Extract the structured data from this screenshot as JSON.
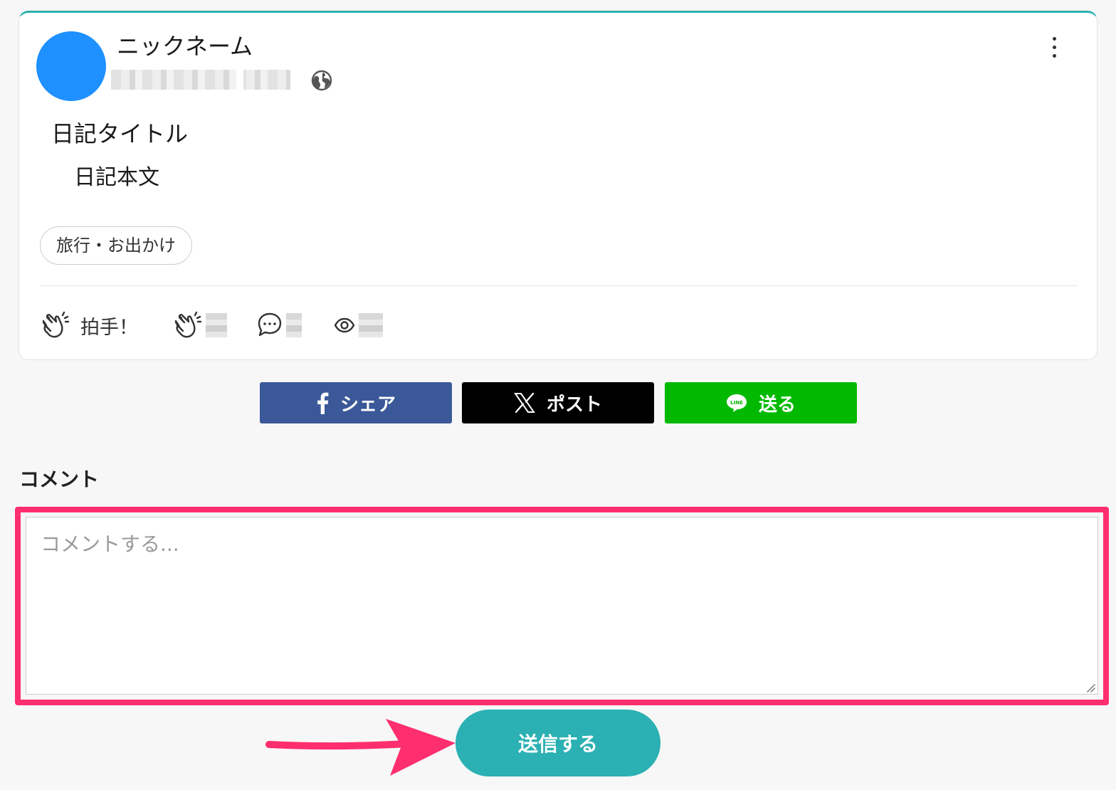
{
  "post": {
    "nickname": "ニックネーム",
    "title": "日記タイトル",
    "body": "日記本文",
    "tag": "旅行・お出かけ",
    "actions": {
      "clap_label": "拍手！"
    }
  },
  "icons": {
    "globe": "globe-icon",
    "kebab": "more-vertical-icon",
    "clap": "clap-icon",
    "comment": "speech-bubble-icon",
    "views": "eye-icon",
    "facebook": "facebook-icon",
    "x": "x-logo-icon",
    "line": "line-logo-icon"
  },
  "share": {
    "facebook_label": "シェア",
    "x_label": "ポスト",
    "line_label": "送る"
  },
  "comment": {
    "heading": "コメント",
    "placeholder": "コメントする...",
    "value": "",
    "submit_label": "送信する"
  },
  "colors": {
    "accent": "#2bb0b3",
    "avatar": "#1e90ff",
    "facebook": "#3b5998",
    "x": "#000000",
    "line": "#00b900",
    "highlight": "#ff2e6e"
  }
}
